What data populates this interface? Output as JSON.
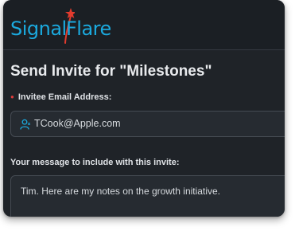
{
  "logo": {
    "word1": "Signal",
    "word2": "Flare"
  },
  "colors": {
    "brand": "#1ba9de",
    "flame": "#e23b2e",
    "required": "#e03c3c",
    "background": "#1f2328"
  },
  "form": {
    "title": "Send Invite for \"Milestones\"",
    "email": {
      "label": "Invitee Email Address:",
      "required": true,
      "icon": "person-icon",
      "value": "TCook@Apple.com"
    },
    "message": {
      "label": "Your message to include with this invite:",
      "value": "Tim. Here are my notes on the growth initiative."
    }
  }
}
